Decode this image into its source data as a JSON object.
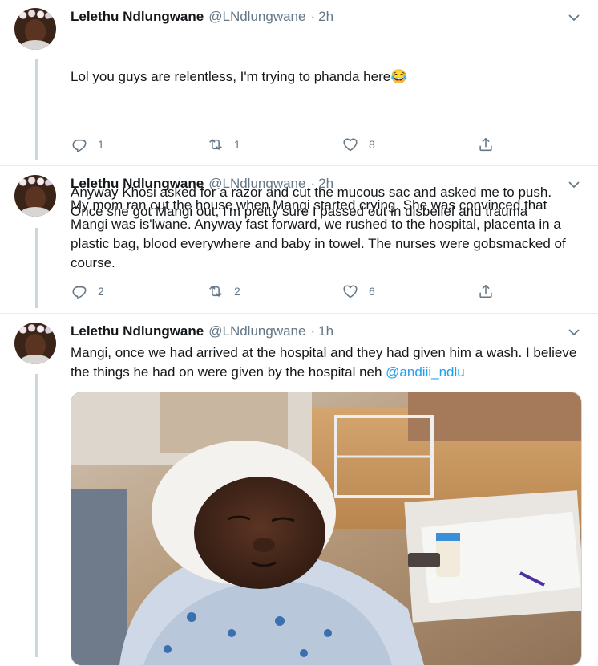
{
  "tweets": [
    {
      "name": "Lelethu Ndlungwane",
      "handle": "@LNdlungwane",
      "dot": "·",
      "time": "2h",
      "text_line1": "Lol you guys are relentless, I'm trying to phanda here😂",
      "text_line2": "Anyway Khosi asked for a razor and cut the mucous sac and asked me to push. Once she got Mangi out, I'm pretty sure I passed out in disbelief and trauma",
      "replies": "1",
      "retweets": "1",
      "likes": "8"
    },
    {
      "name": "Lelethu Ndlungwane",
      "handle": "@LNdlungwane",
      "dot": "·",
      "time": "2h",
      "text": "My mom ran out the house when Mangi started crying. She was convinced that Mangi was is'lwane. Anyway fast forward, we rushed to the hospital, placenta in a plastic bag, blood everywhere and baby in towel. The nurses were gobsmacked of course.",
      "replies": "2",
      "retweets": "2",
      "likes": "6"
    },
    {
      "name": "Lelethu Ndlungwane",
      "handle": "@LNdlungwane",
      "dot": "·",
      "time": "1h",
      "text": "Mangi, once we had arrived at the hospital and they had given him a wash. I believe  the things he had on were given by the hospital neh ",
      "mention": "@andiii_ndlu",
      "media": "newborn-baby-photo"
    }
  ],
  "icons": [
    "reply-icon",
    "retweet-icon",
    "like-icon",
    "share-icon",
    "chevron-down-icon"
  ],
  "colors": {
    "text": "#14171a",
    "secondary": "#657786",
    "link": "#1da1f2",
    "thread": "#ccd6dd"
  }
}
